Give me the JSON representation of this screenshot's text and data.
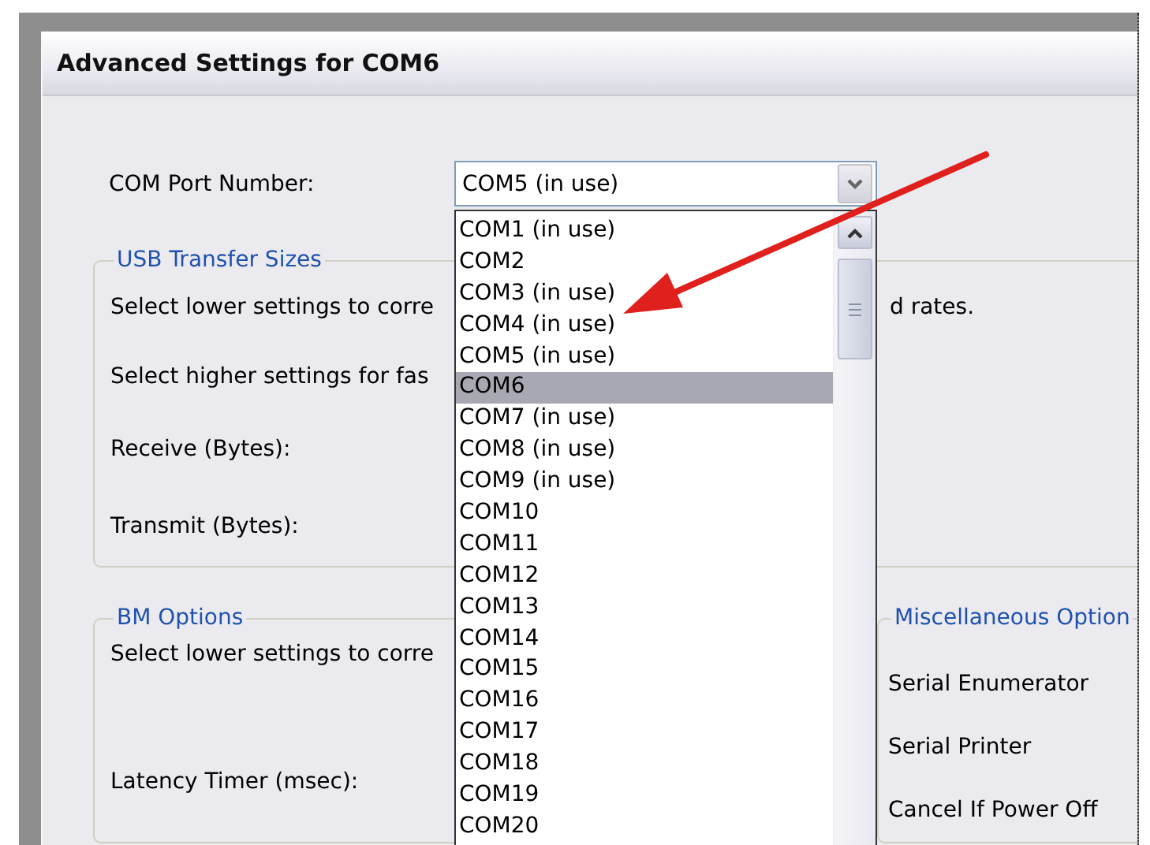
{
  "window": {
    "title": "Advanced Settings for COM6"
  },
  "com_port": {
    "label": "COM Port Number:",
    "value": "COM5 (in use)",
    "expanded": true,
    "options": [
      {
        "label": "COM1 (in use)",
        "highlighted": false
      },
      {
        "label": "COM2",
        "highlighted": false
      },
      {
        "label": "COM3 (in use)",
        "highlighted": false
      },
      {
        "label": "COM4 (in use)",
        "highlighted": false
      },
      {
        "label": "COM5 (in use)",
        "highlighted": false
      },
      {
        "label": "COM6",
        "highlighted": true
      },
      {
        "label": "COM7 (in use)",
        "highlighted": false
      },
      {
        "label": "COM8 (in use)",
        "highlighted": false
      },
      {
        "label": "COM9 (in use)",
        "highlighted": false
      },
      {
        "label": "COM10",
        "highlighted": false
      },
      {
        "label": "COM11",
        "highlighted": false
      },
      {
        "label": "COM12",
        "highlighted": false
      },
      {
        "label": "COM13",
        "highlighted": false
      },
      {
        "label": "COM14",
        "highlighted": false
      },
      {
        "label": "COM15",
        "highlighted": false
      },
      {
        "label": "COM16",
        "highlighted": false
      },
      {
        "label": "COM17",
        "highlighted": false
      },
      {
        "label": "COM18",
        "highlighted": false
      },
      {
        "label": "COM19",
        "highlighted": false
      },
      {
        "label": "COM20",
        "highlighted": false
      }
    ]
  },
  "usb_transfer_sizes": {
    "title": "USB Transfer Sizes",
    "rows": [
      {
        "label": "Select lower settings to corre",
        "after": "d rates."
      },
      {
        "label": "Select higher settings for fas"
      },
      {
        "label": "Receive (Bytes):"
      },
      {
        "label": "Transmit (Bytes):"
      }
    ]
  },
  "bm_options": {
    "title": "BM Options",
    "rows": [
      {
        "label": "Select lower settings to corre"
      },
      {
        "label": "Latency Timer (msec):"
      }
    ]
  },
  "miscellaneous_options": {
    "title": "Miscellaneous Option",
    "items": [
      "Serial Enumerator",
      "Serial Printer",
      "Cancel If Power Off"
    ]
  }
}
